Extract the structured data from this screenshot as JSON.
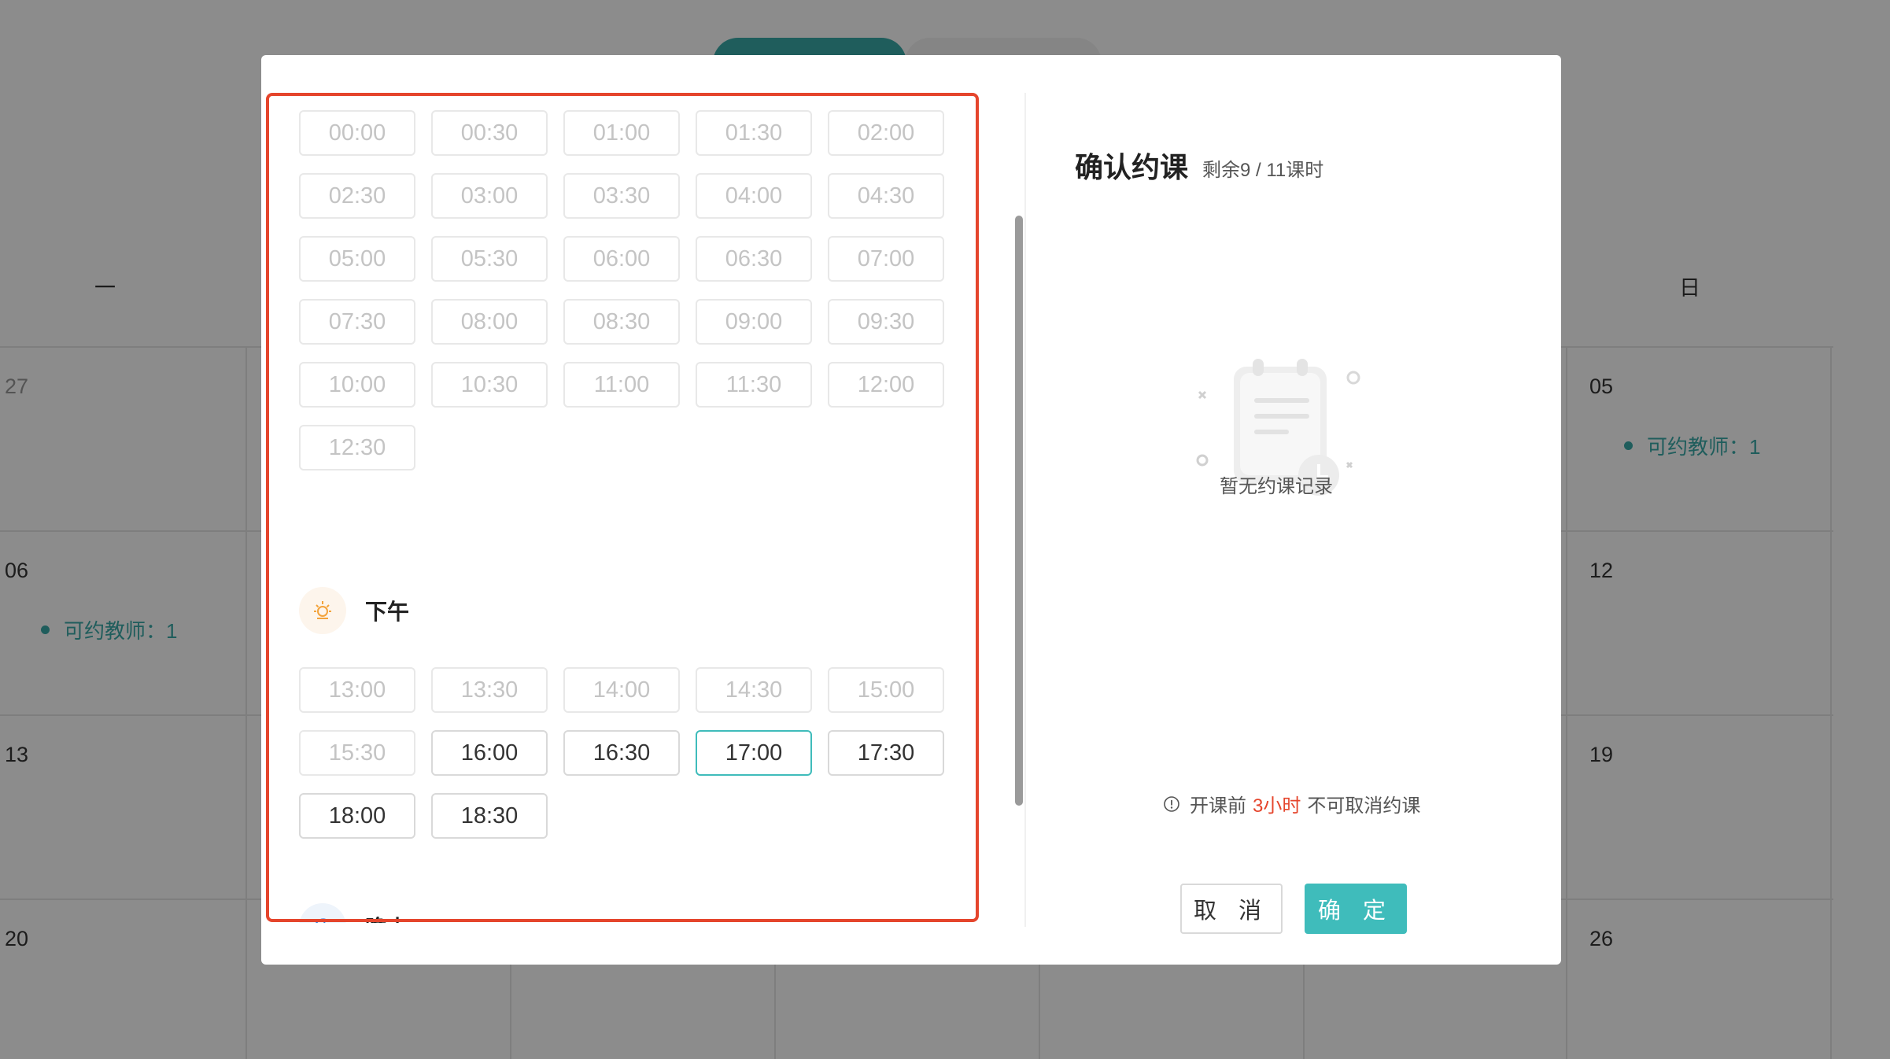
{
  "calendar": {
    "weekdays": {
      "mon": "一",
      "sun": "日"
    },
    "days": {
      "d27": "27",
      "d05": "05",
      "d06": "06",
      "d12": "12",
      "d13": "13",
      "d19": "19",
      "d20": "20",
      "d26": "26"
    },
    "available_teachers": "可约教师：1"
  },
  "modal": {
    "morning_slots": [
      [
        "00:00",
        "00:30",
        "01:00",
        "01:30",
        "02:00"
      ],
      [
        "02:30",
        "03:00",
        "03:30",
        "04:00",
        "04:30"
      ],
      [
        "05:00",
        "05:30",
        "06:00",
        "06:30",
        "07:00"
      ],
      [
        "07:30",
        "08:00",
        "08:30",
        "09:00",
        "09:30"
      ],
      [
        "10:00",
        "10:30",
        "11:00",
        "11:30",
        "12:00"
      ],
      [
        "12:30"
      ]
    ],
    "afternoon": {
      "title": "下午",
      "rows": [
        [
          "13:00",
          "13:30",
          "14:00",
          "14:30",
          "15:00"
        ],
        [
          "15:30",
          "16:00",
          "16:30",
          "17:00",
          "17:30"
        ],
        [
          "18:00",
          "18:30"
        ]
      ],
      "selected": "17:00"
    },
    "evening": {
      "title": "晚上"
    },
    "confirm": {
      "title": "确认约课",
      "remaining": "剩余9 / 11课时",
      "empty_text": "暂无约课记录",
      "notice_prefix": "开课前",
      "notice_highlight": "3小时",
      "notice_suffix": "不可取消约课",
      "cancel_label": "取 消",
      "ok_label": "确 定"
    }
  },
  "colors": {
    "accent": "#3fbcbb",
    "highlight_border": "#e5452c",
    "warning": "#e5452c"
  }
}
